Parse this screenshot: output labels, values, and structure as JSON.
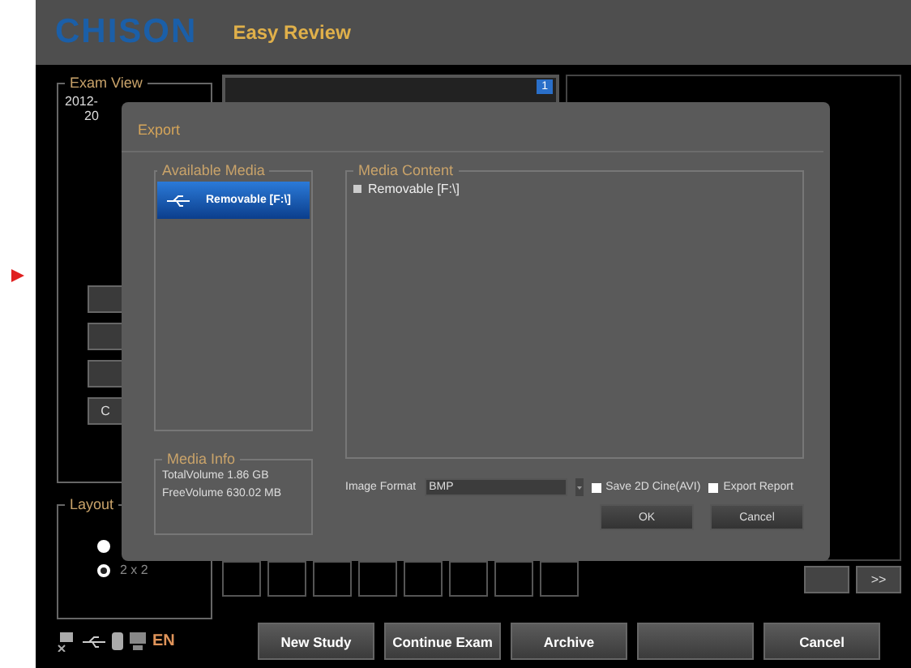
{
  "header": {
    "logo": "CHISON",
    "title": "Easy Review"
  },
  "exam_view": {
    "legend": "Exam View",
    "tree": [
      {
        "label": "2012-",
        "children": [
          {
            "label": "20"
          }
        ]
      }
    ]
  },
  "preview_badge": "1",
  "side_button_label": "C",
  "layout": {
    "legend": "Layout",
    "options": [
      {
        "selected": false
      },
      {
        "label": "2 x 2",
        "selected": true
      }
    ]
  },
  "nav_button": ">>",
  "status": {
    "language": "EN"
  },
  "bottom_buttons_left": [
    "New Study",
    "Continue Exam",
    "Archive"
  ],
  "bottom_buttons_right": [
    "Cancel"
  ],
  "dialog": {
    "title": "Export",
    "available_media": {
      "legend": "Available Media",
      "items": [
        {
          "label": "Removable [F:\\]",
          "selected": true
        }
      ]
    },
    "media_info": {
      "legend": "Media Info",
      "total": "TotalVolume 1.86 GB",
      "free": "FreeVolume 630.02 MB"
    },
    "media_content": {
      "legend": "Media Content",
      "tree": [
        {
          "label": "Removable [F:\\]",
          "expanded": false
        }
      ]
    },
    "image_format": {
      "label": "Image Format",
      "value": "BMP"
    },
    "checkboxes": [
      {
        "label": "Save 2D Cine(AVI)",
        "checked": false
      },
      {
        "label": "Export Report",
        "checked": false
      }
    ],
    "buttons": [
      "OK",
      "Cancel"
    ]
  }
}
